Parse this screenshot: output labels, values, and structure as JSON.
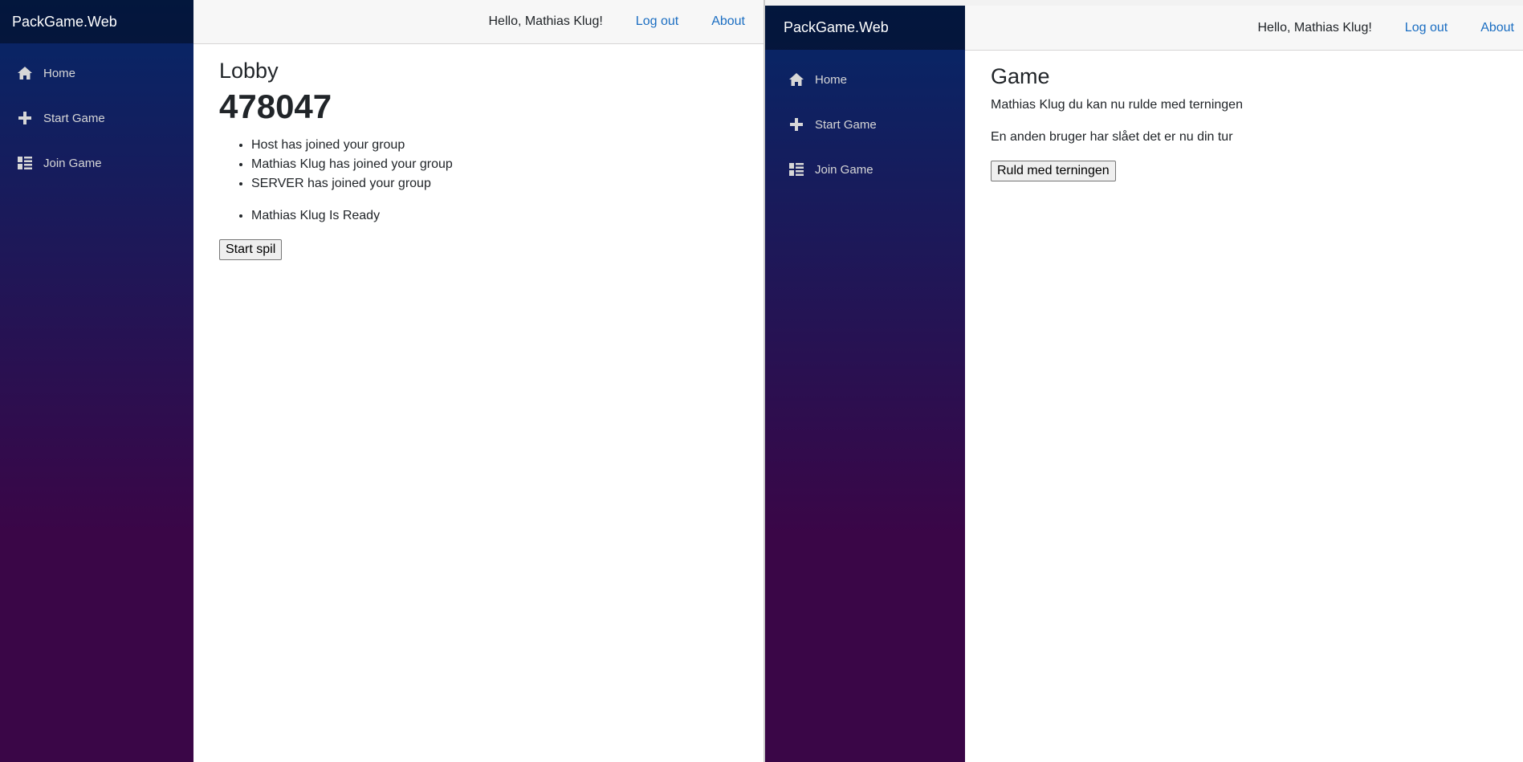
{
  "lobby_window": {
    "brand": "PackGame.Web",
    "nav": [
      {
        "label": "Home",
        "icon": "home-icon"
      },
      {
        "label": "Start Game",
        "icon": "plus-icon"
      },
      {
        "label": "Join Game",
        "icon": "list-icon"
      }
    ],
    "topbar": {
      "greeting": "Hello, Mathias Klug!",
      "logout": "Log out",
      "about": "About"
    },
    "title": "Lobby",
    "code": "478047",
    "messages": [
      "Host has joined your group",
      "Mathias Klug has joined your group",
      "SERVER has joined your group"
    ],
    "ready": [
      "Mathias Klug Is Ready"
    ],
    "start_button": "Start spil"
  },
  "game_window": {
    "brand": "PackGame.Web",
    "nav": [
      {
        "label": "Home",
        "icon": "home-icon"
      },
      {
        "label": "Start Game",
        "icon": "plus-icon"
      },
      {
        "label": "Join Game",
        "icon": "list-icon"
      }
    ],
    "topbar": {
      "greeting": "Hello, Mathias Klug!",
      "logout": "Log out",
      "about": "About"
    },
    "title": "Game",
    "turn_message": "Mathias Klug du kan nu rulde med terningen",
    "status_message": "En anden bruger har slået det er nu din tur",
    "roll_button": "Ruld med terningen"
  },
  "colors": {
    "sidebar_top": "#052767",
    "sidebar_bottom": "#3a0647",
    "link": "#1b6ec2",
    "topbar_bg": "#f7f7f7"
  }
}
